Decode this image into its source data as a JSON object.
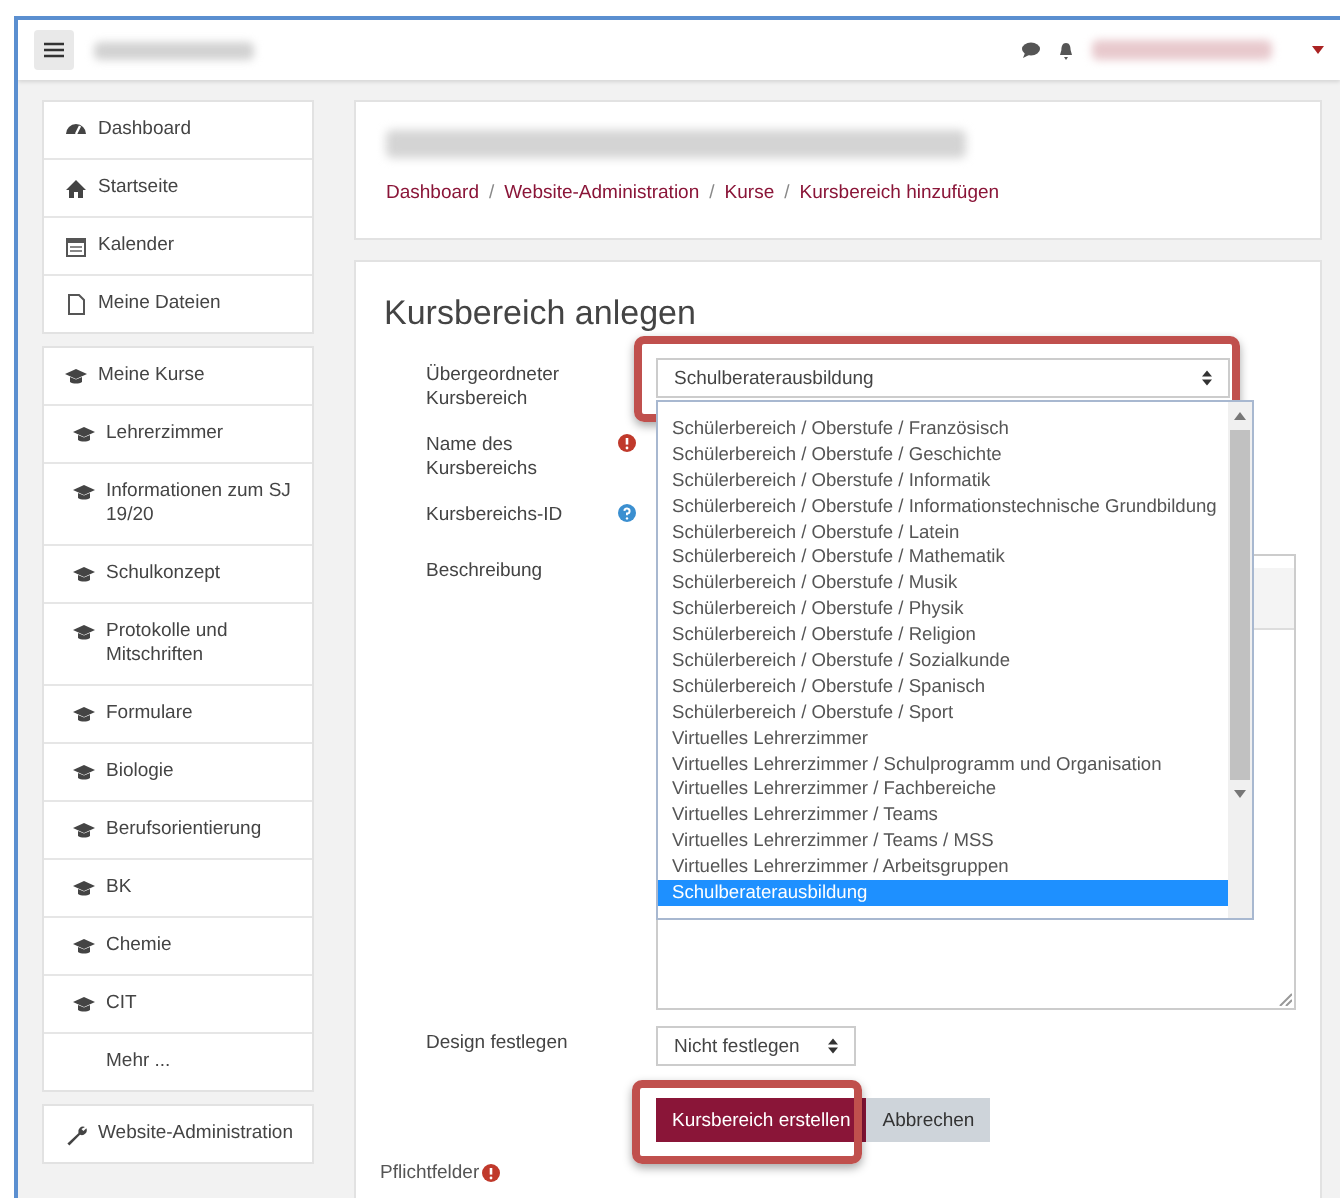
{
  "sidebar": {
    "groups": [
      [
        {
          "label": "Dashboard",
          "kind": "dashboard"
        },
        {
          "label": "Startseite",
          "kind": "home"
        },
        {
          "label": "Kalender",
          "kind": "calendar"
        },
        {
          "label": "Meine Dateien",
          "kind": "files"
        }
      ],
      [
        {
          "label": "Meine Kurse",
          "kind": "course",
          "children": [
            {
              "label": "Lehrerzimmer",
              "kind": "course"
            },
            {
              "label": "Informationen zum SJ 19/20",
              "kind": "course"
            },
            {
              "label": "Schulkonzept",
              "kind": "course"
            },
            {
              "label": "Protokolle und Mitschriften",
              "kind": "course"
            },
            {
              "label": "Formulare",
              "kind": "course"
            },
            {
              "label": "Biologie",
              "kind": "course"
            },
            {
              "label": "Berufsorientierung",
              "kind": "course"
            },
            {
              "label": "BK",
              "kind": "course"
            },
            {
              "label": "Chemie",
              "kind": "course"
            },
            {
              "label": "CIT",
              "kind": "course"
            },
            {
              "label": "Mehr ...",
              "kind": "more"
            }
          ]
        }
      ],
      [
        {
          "label": "Website-Administration",
          "kind": "admin"
        }
      ]
    ]
  },
  "breadcrumb": [
    {
      "text": "Dashboard",
      "kind": "link"
    },
    {
      "text": "/",
      "kind": "separator"
    },
    {
      "text": "Website-Administration",
      "kind": "link"
    },
    {
      "text": "/",
      "kind": "separator"
    },
    {
      "text": "Kurse",
      "kind": "link"
    },
    {
      "text": "/",
      "kind": "separator"
    },
    {
      "text": "Kursbereich hinzufügen",
      "kind": "link"
    }
  ],
  "form": {
    "title": "Kursbereich anlegen",
    "fields": [
      {
        "label": "Übergeordneter Kursbereich",
        "kind": "select",
        "value": "Schulberaterausbildung",
        "highlighted": true
      },
      {
        "label": "Name des Kursbereichs",
        "kind": "text",
        "required": true
      },
      {
        "label": "Kursbereichs-ID",
        "kind": "text",
        "help": true
      },
      {
        "label": "Beschreibung",
        "kind": "editor"
      },
      {
        "label": "Design festlegen",
        "kind": "select",
        "value": "Nicht festlegen",
        "highlighted": false
      }
    ],
    "dropdown": {
      "options": [
        {
          "label": "Schülerbereich / Oberstufe / Französisch",
          "selected": false
        },
        {
          "label": "Schülerbereich / Oberstufe / Geschichte",
          "selected": false
        },
        {
          "label": "Schülerbereich / Oberstufe / Informatik",
          "selected": false
        },
        {
          "label": "Schülerbereich / Oberstufe / Informationstechnische Grundbildung",
          "selected": false
        },
        {
          "label": "Schülerbereich / Oberstufe / Latein",
          "selected": false
        },
        {
          "label": "Schülerbereich / Oberstufe / Mathematik",
          "selected": false
        },
        {
          "label": "Schülerbereich / Oberstufe / Musik",
          "selected": false
        },
        {
          "label": "Schülerbereich / Oberstufe / Physik",
          "selected": false
        },
        {
          "label": "Schülerbereich / Oberstufe / Religion",
          "selected": false
        },
        {
          "label": "Schülerbereich / Oberstufe / Sozialkunde",
          "selected": false
        },
        {
          "label": "Schülerbereich / Oberstufe / Spanisch",
          "selected": false
        },
        {
          "label": "Schülerbereich / Oberstufe / Sport",
          "selected": false
        },
        {
          "label": "Virtuelles Lehrerzimmer",
          "selected": false
        },
        {
          "label": "Virtuelles Lehrerzimmer / Schulprogramm und Organisation",
          "selected": false
        },
        {
          "label": "Virtuelles Lehrerzimmer / Fachbereiche",
          "selected": false
        },
        {
          "label": "Virtuelles Lehrerzimmer / Teams",
          "selected": false
        },
        {
          "label": "Virtuelles Lehrerzimmer / Teams / MSS",
          "selected": false
        },
        {
          "label": "Virtuelles Lehrerzimmer / Arbeitsgruppen",
          "selected": false
        },
        {
          "label": "Schulberaterausbildung",
          "selected": true
        }
      ]
    },
    "buttons": [
      {
        "label": "Kursbereich erstellen",
        "kind": "primary",
        "highlighted": true
      },
      {
        "label": "Abbrechen",
        "kind": "secondary",
        "highlighted": false
      }
    ],
    "required_note": "Pflichtfelder"
  }
}
